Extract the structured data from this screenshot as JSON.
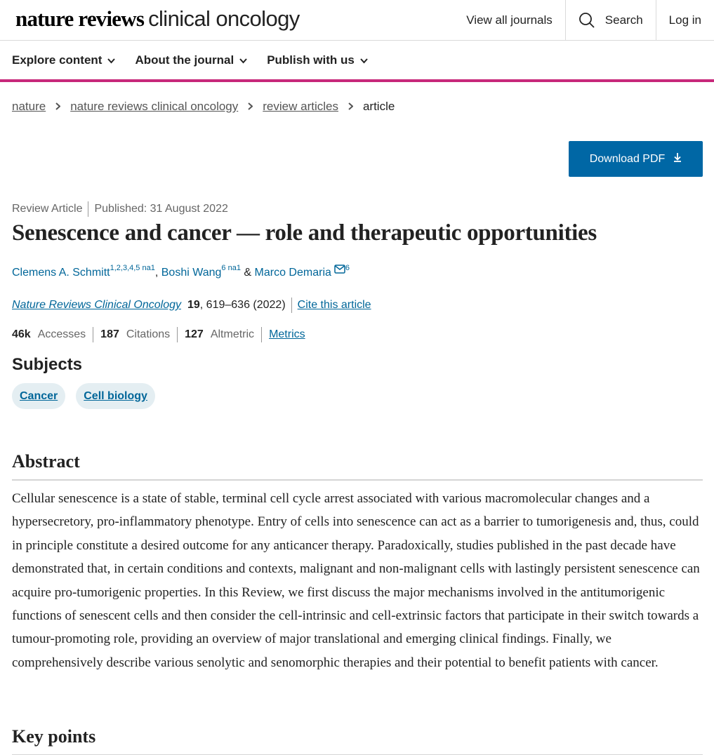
{
  "header": {
    "logo_bold": "nature reviews",
    "logo_light": "clinical oncology",
    "view_all_journals": "View all journals",
    "search_label": "Search",
    "login_label": "Log in"
  },
  "nav": {
    "items": [
      {
        "label": "Explore content"
      },
      {
        "label": "About the journal"
      },
      {
        "label": "Publish with us"
      }
    ]
  },
  "breadcrumb": {
    "items": [
      "nature",
      "nature reviews clinical oncology",
      "review articles"
    ],
    "current": "article"
  },
  "download_pdf": "Download PDF",
  "article": {
    "type": "Review Article",
    "published": "Published: 31 August 2022",
    "title": "Senescence and cancer — role and therapeutic opportunities",
    "authors": [
      {
        "name": "Clemens A. Schmitt",
        "affils": "1,2,3,4,5",
        "note": "na1"
      },
      {
        "name": "Boshi Wang",
        "affils": "6",
        "note": "na1"
      },
      {
        "name": "Marco Demaria",
        "affils": "6"
      }
    ],
    "author_sep_1": ", ",
    "author_sep_2": " & ",
    "journal": "Nature Reviews Clinical Oncology",
    "volume": "19",
    "pages_year": ", 619–636 (2022)",
    "cite_label": "Cite this article",
    "metrics": {
      "accesses_value": "46k",
      "accesses_label": "Accesses",
      "citations_value": "187",
      "citations_label": "Citations",
      "altmetric_value": "127",
      "altmetric_label": "Altmetric",
      "metrics_link": "Metrics"
    },
    "subjects_title": "Subjects",
    "subjects": [
      "Cancer",
      "Cell biology"
    ]
  },
  "abstract": {
    "heading": "Abstract",
    "text": "Cellular senescence is a state of stable, terminal cell cycle arrest associated with various macromolecular changes and a hypersecretory, pro-inflammatory phenotype. Entry of cells into senescence can act as a barrier to tumorigenesis and, thus, could in principle constitute a desired outcome for any anticancer therapy. Paradoxically, studies published in the past decade have demonstrated that, in certain conditions and contexts, malignant and non-malignant cells with lastingly persistent senescence can acquire pro-tumorigenic properties. In this Review, we first discuss the major mechanisms involved in the antitumorigenic functions of senescent cells and then consider the cell-intrinsic and cell-extrinsic factors that participate in their switch towards a tumour-promoting role, providing an overview of major translational and emerging clinical findings. Finally, we comprehensively describe various senolytic and senomorphic therapies and their potential to benefit patients with cancer."
  },
  "key_points": {
    "heading": "Key points"
  },
  "colors": {
    "accent": "#c7287a",
    "link": "#006699",
    "button": "#0067a5",
    "chip_bg": "#e4eef2"
  }
}
